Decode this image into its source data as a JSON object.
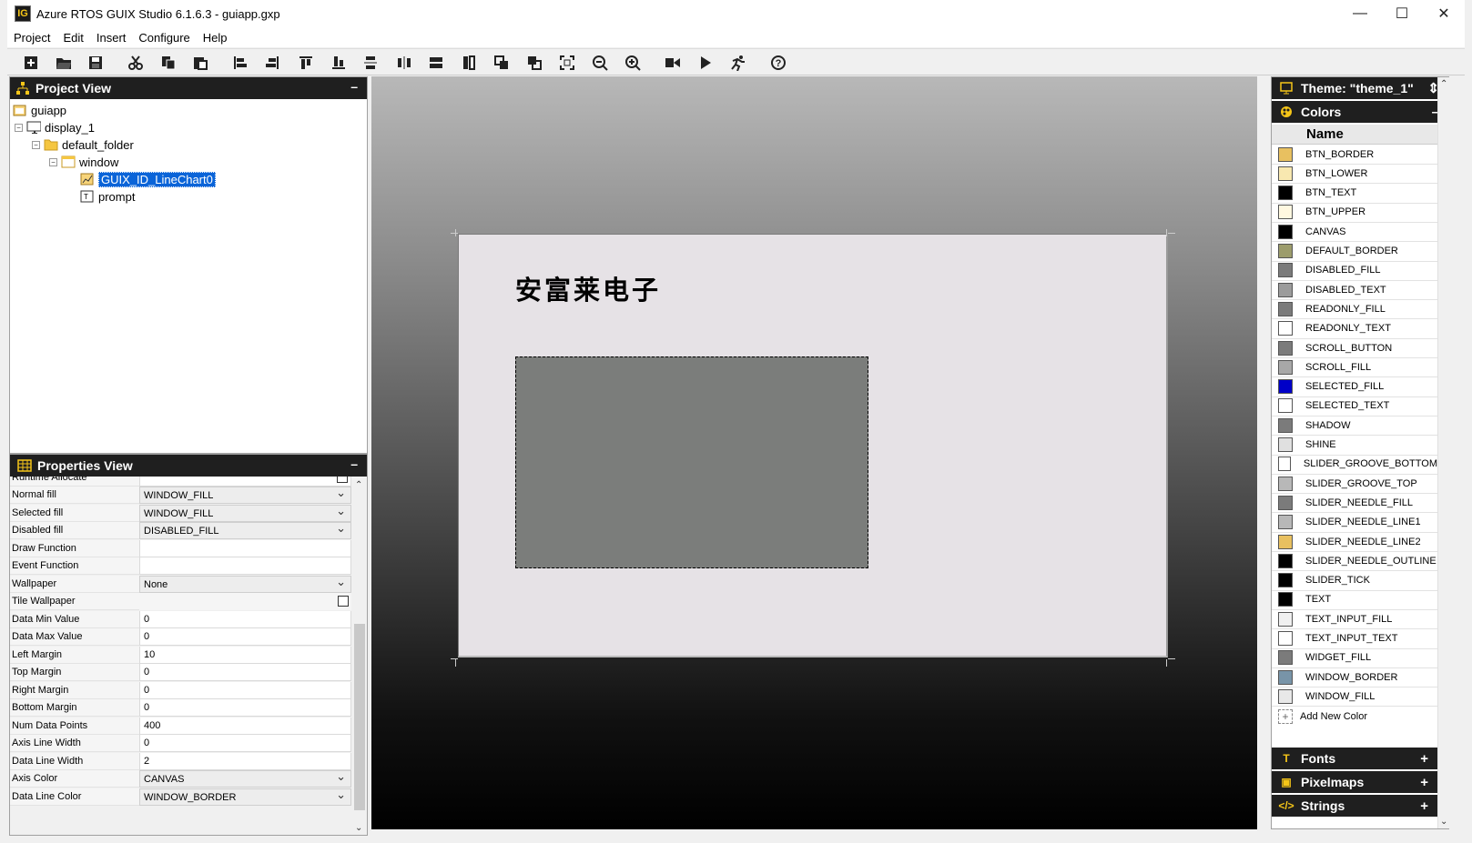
{
  "window": {
    "title": "Azure RTOS GUIX Studio 6.1.6.3 - guiapp.gxp",
    "logo": "IG",
    "minimize": "—",
    "maximize": "☐",
    "close": "✕"
  },
  "menu": [
    "Project",
    "Edit",
    "Insert",
    "Configure",
    "Help"
  ],
  "toolbar_icons": [
    "new-project-icon",
    "open-icon",
    "save-icon",
    "cut-icon",
    "copy-icon",
    "paste-icon",
    "align-left-icon",
    "align-right-icon",
    "align-top-icon",
    "align-bottom-icon",
    "v-space-equally-icon",
    "h-space-equally-icon",
    "equal-width-icon",
    "equal-height-icon",
    "move-to-front-icon",
    "move-to-back-icon",
    "size-to-fit-icon",
    "zoom-out-icon",
    "zoom-in-icon",
    "record-macro-icon",
    "playback-macro-icon",
    "run-app-icon",
    "about-icon"
  ],
  "project_view": {
    "title": "Project View",
    "min": "–",
    "tree": [
      {
        "label": "guiapp",
        "icon": "project-icon",
        "level": 0
      },
      {
        "label": "display_1",
        "icon": "display-icon",
        "level": 1,
        "exp": "−"
      },
      {
        "label": "default_folder",
        "icon": "folder-icon",
        "level": 2,
        "exp": "−"
      },
      {
        "label": "window",
        "icon": "window-icon",
        "level": 3,
        "exp": "−"
      },
      {
        "label": "GUIX_ID_LineChart0",
        "icon": "line-chart-icon",
        "level": 4,
        "selected": true
      },
      {
        "label": "prompt",
        "icon": "prompt-icon",
        "level": 4
      }
    ]
  },
  "properties_view": {
    "title": "Properties View",
    "min": "–",
    "partial_row": "Runtime Allocate",
    "rows": [
      {
        "name": "Normal fill",
        "value": "WINDOW_FILL",
        "type": "dropdown"
      },
      {
        "name": "Selected fill",
        "value": "WINDOW_FILL",
        "type": "dropdown"
      },
      {
        "name": "Disabled fill",
        "value": "DISABLED_FILL",
        "type": "dropdown"
      },
      {
        "name": "Draw Function",
        "value": "",
        "type": "text"
      },
      {
        "name": "Event Function",
        "value": "",
        "type": "text"
      },
      {
        "name": "Wallpaper",
        "value": "None",
        "type": "dropdown"
      },
      {
        "name": "Tile Wallpaper",
        "value": "",
        "type": "checkbox"
      },
      {
        "name": "Data Min Value",
        "value": "0",
        "type": "text"
      },
      {
        "name": "Data Max Value",
        "value": "0",
        "type": "text"
      },
      {
        "name": "Left Margin",
        "value": "10",
        "type": "text"
      },
      {
        "name": "Top Margin",
        "value": "0",
        "type": "text"
      },
      {
        "name": "Right Margin",
        "value": "0",
        "type": "text"
      },
      {
        "name": "Bottom Margin",
        "value": "0",
        "type": "text"
      },
      {
        "name": "Num Data Points",
        "value": "400",
        "type": "text"
      },
      {
        "name": "Axis Line Width",
        "value": "0",
        "type": "text"
      },
      {
        "name": "Data Line Width",
        "value": "2",
        "type": "text"
      },
      {
        "name": "Axis Color",
        "value": "CANVAS",
        "type": "dropdown"
      },
      {
        "name": "Data Line Color",
        "value": "WINDOW_BORDER",
        "type": "dropdown"
      }
    ]
  },
  "canvas": {
    "window_fill": "#e6e2e6",
    "chart_fill": "#7b7d7b",
    "prompt_text": "安富莱电子"
  },
  "theme": {
    "label": "Theme: \"theme_1\"",
    "spin": "⇕"
  },
  "colors_panel": {
    "title": "Colors",
    "toggle": "–",
    "header": "Name",
    "add_label": "Add New Color",
    "items": [
      {
        "name": "BTN_BORDER",
        "color": "#e8c060"
      },
      {
        "name": "BTN_LOWER",
        "color": "#f8e8b0"
      },
      {
        "name": "BTN_TEXT",
        "color": "#000000"
      },
      {
        "name": "BTN_UPPER",
        "color": "#fff8e0"
      },
      {
        "name": "CANVAS",
        "color": "#000000"
      },
      {
        "name": "DEFAULT_BORDER",
        "color": "#9c9c6c"
      },
      {
        "name": "DISABLED_FILL",
        "color": "#7b7b7b"
      },
      {
        "name": "DISABLED_TEXT",
        "color": "#9c9c9c"
      },
      {
        "name": "READONLY_FILL",
        "color": "#7b7b7b"
      },
      {
        "name": "READONLY_TEXT",
        "color": "#ffffff"
      },
      {
        "name": "SCROLL_BUTTON",
        "color": "#7b7b7b"
      },
      {
        "name": "SCROLL_FILL",
        "color": "#a8a8a8"
      },
      {
        "name": "SELECTED_FILL",
        "color": "#0000c8"
      },
      {
        "name": "SELECTED_TEXT",
        "color": "#ffffff"
      },
      {
        "name": "SHADOW",
        "color": "#7b7b7b"
      },
      {
        "name": "SHINE",
        "color": "#e0e0e0"
      },
      {
        "name": "SLIDER_GROOVE_BOTTOM",
        "color": "#ffffff"
      },
      {
        "name": "SLIDER_GROOVE_TOP",
        "color": "#b8b8b8"
      },
      {
        "name": "SLIDER_NEEDLE_FILL",
        "color": "#7b7b7b"
      },
      {
        "name": "SLIDER_NEEDLE_LINE1",
        "color": "#b8b8b8"
      },
      {
        "name": "SLIDER_NEEDLE_LINE2",
        "color": "#e8c060"
      },
      {
        "name": "SLIDER_NEEDLE_OUTLINE",
        "color": "#000000"
      },
      {
        "name": "SLIDER_TICK",
        "color": "#000000"
      },
      {
        "name": "TEXT",
        "color": "#000000"
      },
      {
        "name": "TEXT_INPUT_FILL",
        "color": "#f0f0f0"
      },
      {
        "name": "TEXT_INPUT_TEXT",
        "color": "#ffffff"
      },
      {
        "name": "WIDGET_FILL",
        "color": "#7b7b7b"
      },
      {
        "name": "WINDOW_BORDER",
        "color": "#7894a8"
      },
      {
        "name": "WINDOW_FILL",
        "color": "#e8e8e8"
      }
    ]
  },
  "collapsed_panels": [
    {
      "title": "Fonts",
      "icon": "fonts-icon",
      "glyph": "T",
      "toggle": "+"
    },
    {
      "title": "Pixelmaps",
      "icon": "pixelmaps-icon",
      "glyph": "▣",
      "toggle": "+"
    },
    {
      "title": "Strings",
      "icon": "strings-icon",
      "glyph": "</>",
      "toggle": "+"
    }
  ]
}
